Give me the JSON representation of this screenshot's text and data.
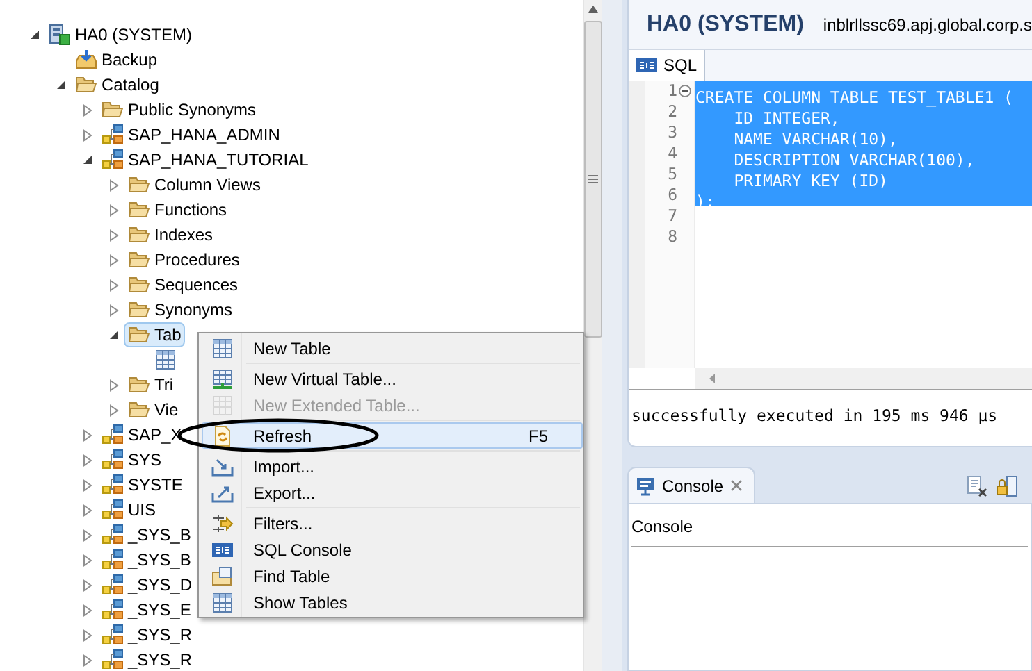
{
  "explorer": {
    "tree": [
      {
        "label": "HA0 (SYSTEM)",
        "kind": "system",
        "expanded": true,
        "selected": false,
        "children": [
          {
            "label": "Backup",
            "kind": "backup",
            "selected": false
          },
          {
            "label": "Catalog",
            "kind": "folder",
            "expanded": true,
            "selected": false,
            "children": [
              {
                "label": "Public Synonyms",
                "kind": "folder",
                "expanded": false,
                "selected": false
              },
              {
                "label": "SAP_HANA_ADMIN",
                "kind": "schema",
                "expanded": false,
                "selected": false
              },
              {
                "label": "SAP_HANA_TUTORIAL",
                "kind": "schema",
                "expanded": true,
                "selected": false,
                "children": [
                  {
                    "label": "Column Views",
                    "kind": "folder",
                    "expanded": false,
                    "selected": false
                  },
                  {
                    "label": "Functions",
                    "kind": "folder",
                    "expanded": false,
                    "selected": false
                  },
                  {
                    "label": "Indexes",
                    "kind": "folder",
                    "expanded": false,
                    "selected": false
                  },
                  {
                    "label": "Procedures",
                    "kind": "folder",
                    "expanded": false,
                    "selected": false
                  },
                  {
                    "label": "Sequences",
                    "kind": "folder",
                    "expanded": false,
                    "selected": false
                  },
                  {
                    "label": "Synonyms",
                    "kind": "folder",
                    "expanded": false,
                    "selected": false
                  },
                  {
                    "label": "Tab",
                    "kind": "folder",
                    "expanded": true,
                    "selected": true,
                    "children": [
                      {
                        "kind": "table",
                        "selected": false
                      }
                    ]
                  },
                  {
                    "label": "Tri",
                    "kind": "folder",
                    "expanded": false,
                    "selected": false
                  },
                  {
                    "label": "Vie",
                    "kind": "folder",
                    "expanded": false,
                    "selected": false
                  }
                ]
              },
              {
                "label": "SAP_X",
                "kind": "schema",
                "expanded": false,
                "selected": false
              },
              {
                "label": "SYS",
                "kind": "schema",
                "expanded": false,
                "selected": false
              },
              {
                "label": "SYSTE",
                "kind": "schema",
                "expanded": false,
                "selected": false
              },
              {
                "label": "UIS",
                "kind": "schema",
                "expanded": false,
                "selected": false
              },
              {
                "label": "_SYS_B",
                "kind": "schema",
                "expanded": false,
                "selected": false
              },
              {
                "label": "_SYS_B",
                "kind": "schema",
                "expanded": false,
                "selected": false
              },
              {
                "label": "_SYS_D",
                "kind": "schema",
                "expanded": false,
                "selected": false
              },
              {
                "label": "_SYS_E",
                "kind": "schema",
                "expanded": false,
                "selected": false
              },
              {
                "label": "_SYS_R",
                "kind": "schema",
                "expanded": false,
                "selected": false
              },
              {
                "label": "_SYS_R",
                "kind": "schema",
                "expanded": false,
                "selected": false
              }
            ]
          }
        ]
      }
    ]
  },
  "context_menu": [
    {
      "kind": "table",
      "label": "New Table",
      "disabled": false,
      "selected": false
    },
    {
      "kind": "separator"
    },
    {
      "kind": "virtual",
      "label": "New Virtual Table...",
      "disabled": false,
      "selected": false
    },
    {
      "kind": "extended",
      "label": "New Extended Table...",
      "disabled": true,
      "selected": false
    },
    {
      "kind": "separator"
    },
    {
      "kind": "refresh",
      "label": "Refresh",
      "shortcut": "F5",
      "disabled": false,
      "selected": true,
      "circled": true
    },
    {
      "kind": "separator"
    },
    {
      "kind": "import",
      "label": "Import...",
      "disabled": false,
      "selected": false
    },
    {
      "kind": "export",
      "label": "Export...",
      "disabled": false,
      "selected": false
    },
    {
      "kind": "separator"
    },
    {
      "kind": "filter",
      "label": "Filters...",
      "disabled": false,
      "selected": false
    },
    {
      "kind": "sql",
      "label": "SQL Console",
      "disabled": false,
      "selected": false
    },
    {
      "kind": "find",
      "label": "Find Table",
      "disabled": false,
      "selected": false
    },
    {
      "kind": "table",
      "label": "Show Tables",
      "disabled": false,
      "selected": false
    }
  ],
  "editor": {
    "title": "HA0 (SYSTEM)",
    "connection": "inblrllssc69.apj.global.corp.s",
    "tabs": [
      {
        "label": "SQL",
        "selected": true
      }
    ],
    "lines": [
      {
        "number": "1",
        "text": "CREATE COLUMN TABLE TEST_TABLE1 (",
        "selected": true,
        "foldable": true
      },
      {
        "number": "2",
        "text": "    ID INTEGER,",
        "selected": true,
        "foldable": false
      },
      {
        "number": "3",
        "text": "    NAME VARCHAR(10),",
        "selected": true,
        "foldable": false
      },
      {
        "number": "4",
        "text": "    DESCRIPTION VARCHAR(100),",
        "selected": true,
        "foldable": false
      },
      {
        "number": "5",
        "text": "    PRIMARY KEY (ID)",
        "selected": true,
        "foldable": false
      },
      {
        "number": "6",
        "text": ");",
        "selected": true,
        "foldable": false
      },
      {
        "number": "7",
        "selected": false,
        "foldable": false
      },
      {
        "number": "8",
        "selected": false,
        "foldable": false
      }
    ],
    "result": "successfully executed in 195 ms 946 µs"
  },
  "console": {
    "tabs": [
      {
        "label": "Console",
        "selected": true
      }
    ],
    "header": "Console"
  }
}
